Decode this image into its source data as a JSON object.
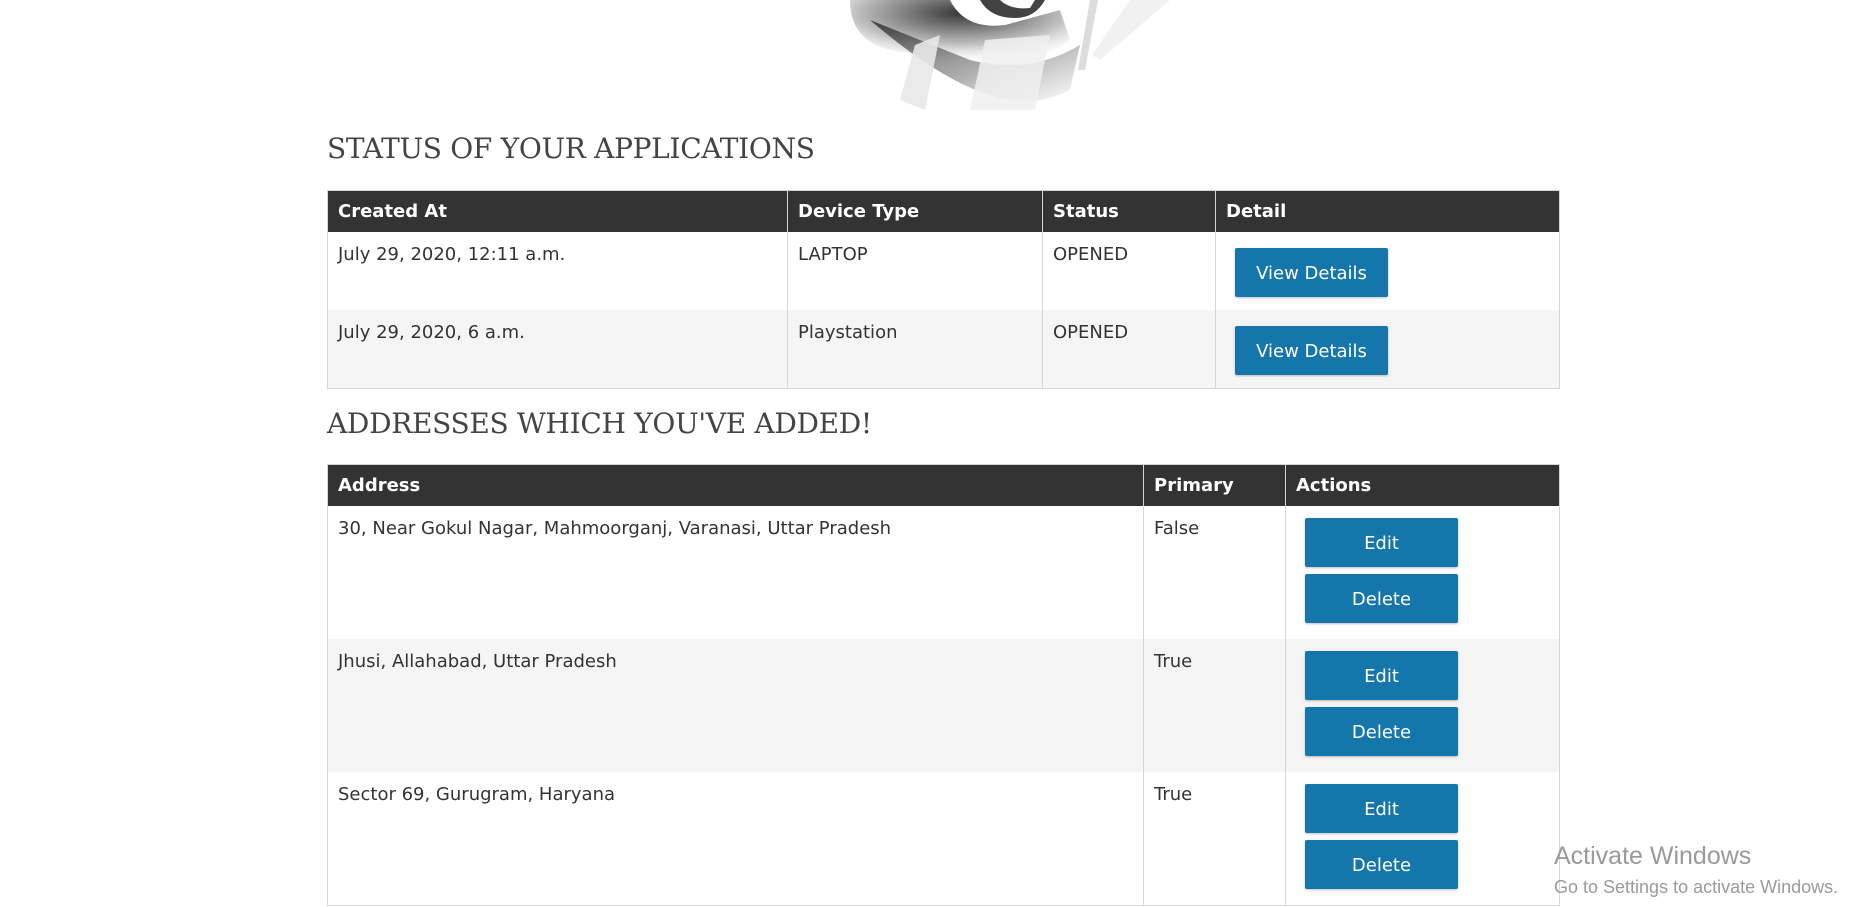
{
  "sections": {
    "applications_title": "STATUS OF YOUR APPLICATIONS",
    "addresses_title": "ADDRESSES WHICH YOU'VE ADDED!"
  },
  "applications": {
    "headers": {
      "created_at": "Created At",
      "device_type": "Device Type",
      "status": "Status",
      "detail": "Detail"
    },
    "rows": [
      {
        "created_at": "July 29, 2020, 12:11 a.m.",
        "device_type": "LAPTOP",
        "status": "OPENED",
        "detail_button": "View Details"
      },
      {
        "created_at": "July 29, 2020, 6 a.m.",
        "device_type": "Playstation",
        "status": "OPENED",
        "detail_button": "View Details"
      }
    ]
  },
  "addresses": {
    "headers": {
      "address": "Address",
      "primary": "Primary",
      "actions": "Actions"
    },
    "rows": [
      {
        "address": "30, Near Gokul Nagar, Mahmoorganj, Varanasi, Uttar Pradesh",
        "primary": "False",
        "edit_button": "Edit",
        "delete_button": "Delete"
      },
      {
        "address": "Jhusi, Allahabad, Uttar Pradesh",
        "primary": "True",
        "edit_button": "Edit",
        "delete_button": "Delete"
      },
      {
        "address": "Sector 69, Gurugram, Haryana",
        "primary": "True",
        "edit_button": "Edit",
        "delete_button": "Delete"
      }
    ]
  },
  "watermark": {
    "title": "Activate Windows",
    "subtitle": "Go to Settings to activate Windows."
  },
  "colors": {
    "header_bg": "#333333",
    "button_bg": "#1476aa",
    "stripe_bg": "#f5f5f5"
  },
  "icons": {
    "hero": "abstract-gradient-shape"
  }
}
